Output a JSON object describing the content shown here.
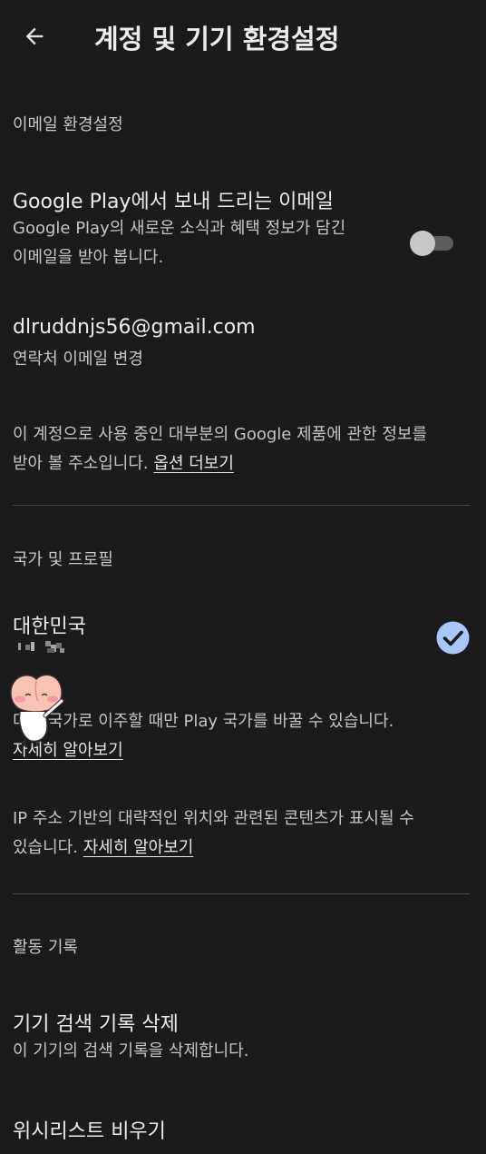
{
  "header": {
    "back_icon": "arrow-left-icon",
    "title": "계정 및 기기 환경설정"
  },
  "email_section": {
    "label": "이메일 환경설정",
    "promo": {
      "title": "Google Play에서 보내 드리는 이메일",
      "desc_line1": "Google Play의 새로운 소식과 혜택 정보가 담긴",
      "desc_line2": "이메일을 받아 봅니다.",
      "toggle_on": false
    },
    "account": {
      "email": "dlruddnjs56@gmail.com",
      "sub": "연락처 이메일 변경"
    },
    "info_text_line1": "이 계정으로 사용 중인 대부분의 Google 제품에 관한 정보를",
    "info_text_line2": "받아 볼 주소입니다.",
    "info_link": "옵션 더보기"
  },
  "country_section": {
    "label": "국가 및 프로필",
    "country": "대한민국",
    "selected": true,
    "change_text": "다른 국가로 이주할 때만 Play 국가를 바꿀 수 있습니다.",
    "change_link": "자세히 알아보기",
    "ip_text_line1": "IP 주소 기반의 대략적인 위치와 관련된 콘텐츠가 표시될 수",
    "ip_text_line2": "있습니다.",
    "ip_link": "자세히 알아보기"
  },
  "activity_section": {
    "label": "활동 기록",
    "clear_search_title": "기기 검색 기록 삭제",
    "clear_search_desc": "이 기기의 검색 기록을 삭제합니다.",
    "clear_wishlist_title": "위시리스트 비우기"
  },
  "colors": {
    "background": "#1b1b1b",
    "accent_check": "#a8c7fa",
    "divider": "#4a4a4a"
  }
}
